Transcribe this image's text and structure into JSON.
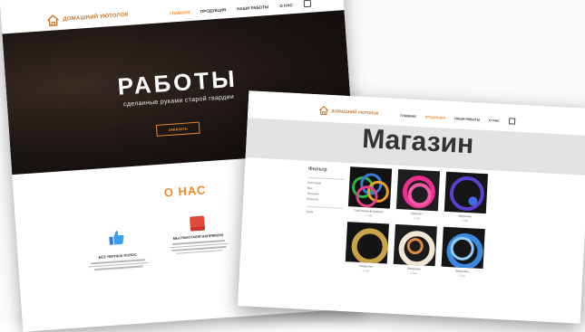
{
  "left_page": {
    "logo_text": "ДОМАШНИЙ УЮТОЛОК",
    "nav": [
      "ГЛАВНАЯ",
      "ПРОДУКЦИЯ",
      "НАШИ РАБОТЫ",
      "О НАС"
    ],
    "hero_title": "РАБОТЫ",
    "hero_subtitle": "сделанные руками старой гвардии",
    "hero_button": "ЗАКАЗАТЬ",
    "about_title": "О НАС",
    "features": [
      {
        "title": "БЕЗ ЧЕРНЫХ ПОЛОС",
        "icon": "thumbs-up-icon"
      },
      {
        "title": "МЫ РАБОТАЕМ НАПРЯМУЮ",
        "icon": "box-icon"
      }
    ]
  },
  "right_page": {
    "logo_text": "ДОМАШНИЙ УЮТОЛОК",
    "nav": [
      "ГЛАВНАЯ",
      "ПРОДУКЦИЯ",
      "НАШИ РАБОТЫ",
      "О НАС"
    ],
    "title": "Магазин",
    "filter_title": "Фильтр",
    "filter_items": [
      "Категории",
      "Все",
      "Женские",
      "Мужские",
      "Цена"
    ],
    "products": [
      {
        "name": "Собственный браслет",
        "price": "1 500"
      },
      {
        "name": "Браслет",
        "price": "1 500"
      },
      {
        "name": "Ожерелье",
        "price": "1 500"
      },
      {
        "name": "Ожерелье",
        "price": "1 500"
      },
      {
        "name": "Ожерелье",
        "price": "1 500"
      },
      {
        "name": "Ожерелье",
        "price": "1 500"
      }
    ]
  },
  "colors": {
    "accent": "#f08a24",
    "hero_dark": "#1b1513",
    "banner_gray": "#e3e3e3"
  }
}
